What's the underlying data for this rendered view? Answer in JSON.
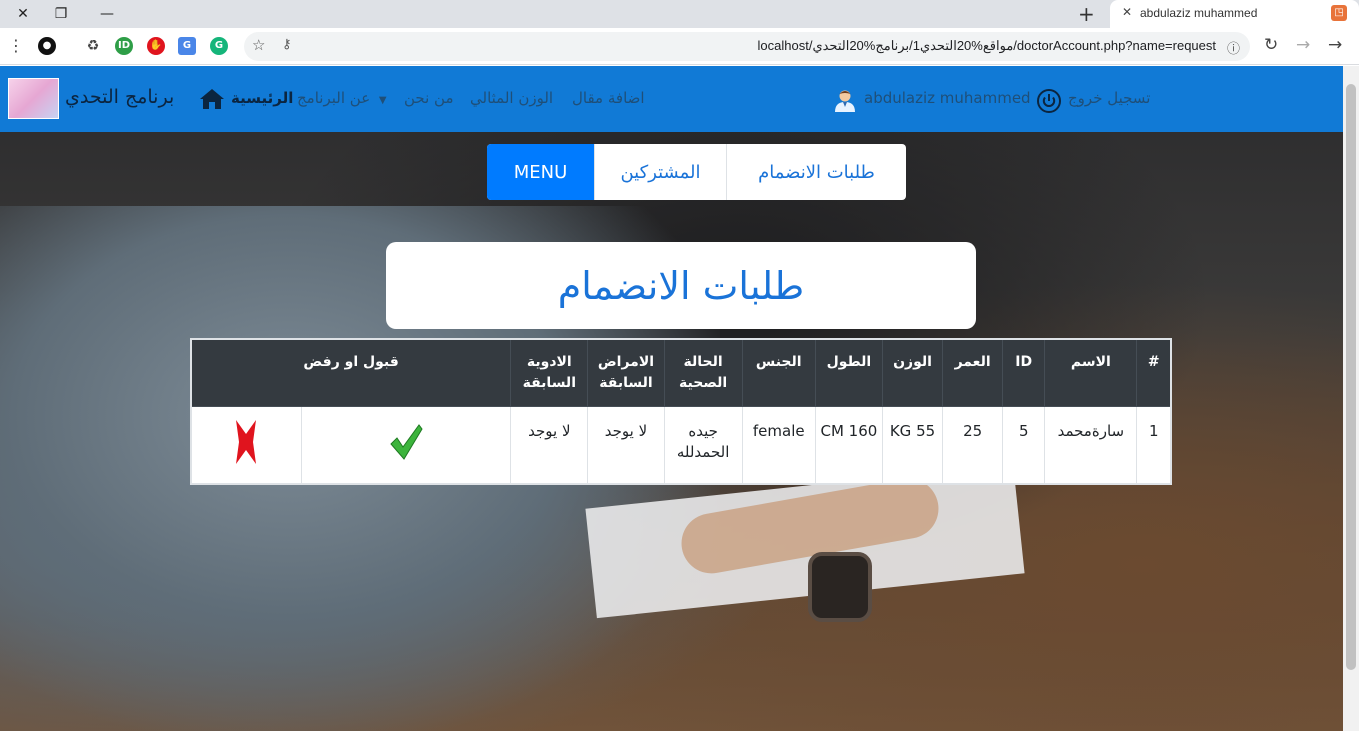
{
  "browser": {
    "tab_title": "abdulaziz muhammed",
    "url": "localhost/مواقع%20التحدي1/برنامج%20التحدي/doctorAccount.php?name=request"
  },
  "navbar": {
    "brand": "برنامج التحدي",
    "home": "الرئيسية",
    "about": "عن البرنامج",
    "who": "من نحن",
    "ideal_weight": "الوزن المثالي",
    "add_article": "اضافة مقال",
    "user": "abdulaziz muhammed",
    "logout": "تسجيل خروج"
  },
  "menu": {
    "main": "MENU",
    "subscribers": "المشتركين",
    "requests": "طلبات الانضمام"
  },
  "page_title": "طلبات الانضمام",
  "table": {
    "headers": {
      "num": "#",
      "name": "الاسم",
      "id": "ID",
      "age": "العمر",
      "weight": "الوزن",
      "height": "الطول",
      "gender": "الجنس",
      "health": "الحالة الصحية",
      "diseases": "الامراض السابقة",
      "medicines": "الادوية السابقة",
      "decision": "قبول او رفض"
    },
    "rows": [
      {
        "num": "1",
        "name": "سارةمحمد",
        "id": "5",
        "age": "25",
        "weight": "55 KG",
        "height": "160 CM",
        "gender": "female",
        "health": "جيده الحمدلله",
        "diseases": "لا يوجد",
        "medicines": "لا يوجد"
      }
    ]
  },
  "colors": {
    "navbar": "#117ad6",
    "menu_active": "#007bff",
    "table_head": "#343a40",
    "accept": "#3cb43c",
    "reject": "#e0141e"
  }
}
